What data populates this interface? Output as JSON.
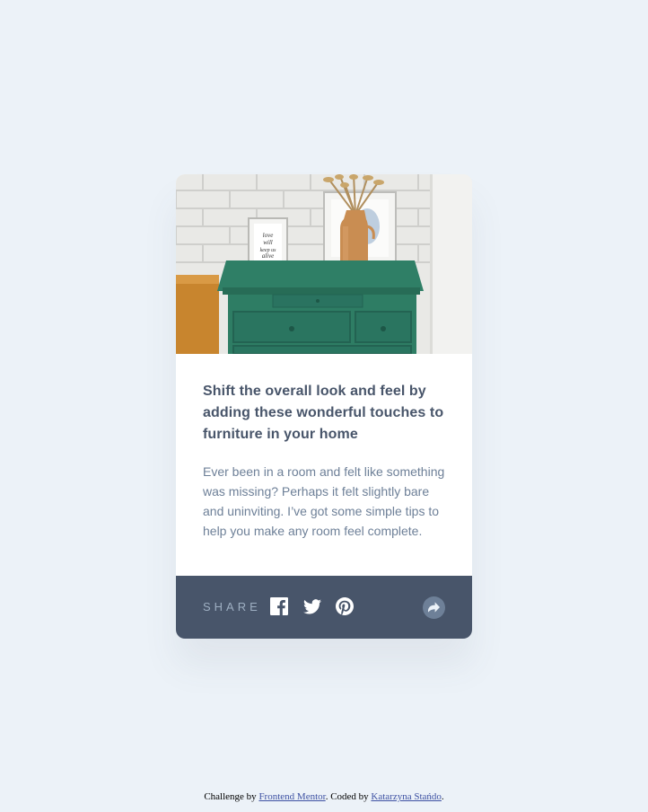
{
  "card": {
    "title": "Shift the overall look and feel by adding these wonderful touches to furniture in your home",
    "description": "Ever been in a room and felt like something was missing? Perhaps it felt slightly bare and uninviting. I’ve got some simple tips to help you make any room feel complete.",
    "share_label": "SHARE",
    "social_icons": [
      "facebook-icon",
      "twitter-icon",
      "pinterest-icon"
    ],
    "share_icon": "share-arrow-icon"
  },
  "footer": {
    "prefix": "Challenge by ",
    "link1": "Frontend Mentor",
    "middle": ". Coded by ",
    "link2": "Katarzyna Stańdo",
    "suffix": "."
  },
  "colors": {
    "page_background": "#ecf2f8",
    "card_background": "#ffffff",
    "title": "#48556a",
    "body_text": "#6e8098",
    "share_bar": "#48556a",
    "share_label": "#9eafc2",
    "share_button": "#6e8098",
    "drawer_green": "#2e7d64"
  }
}
